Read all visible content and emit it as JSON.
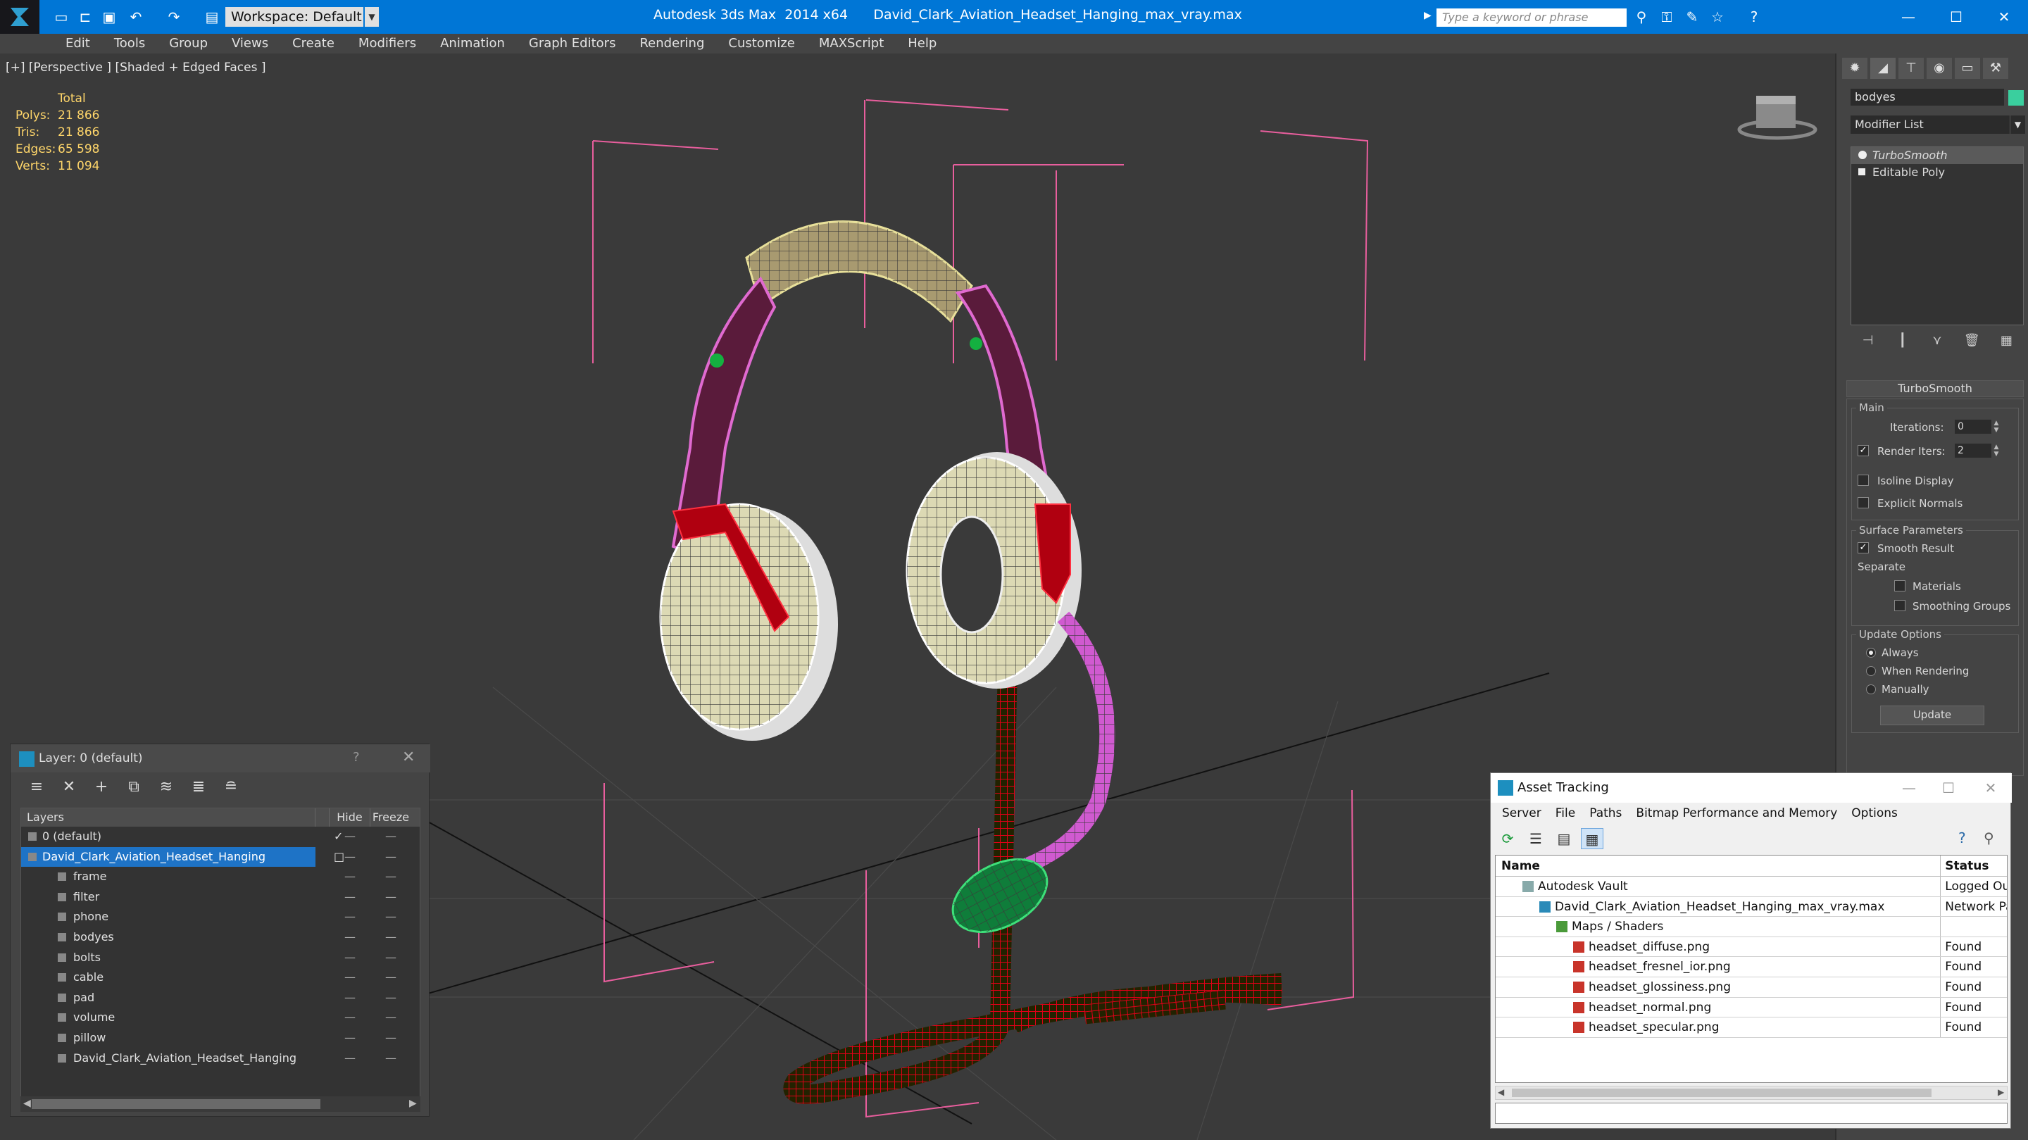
{
  "titlebar": {
    "app_title": "Autodesk 3ds Max  2014 x64",
    "file_name": "David_Clark_Aviation_Headset_Hanging_max_vray.max",
    "workspace": "Workspace: Default",
    "search_placeholder": "Type a keyword or phrase",
    "minimize": "—",
    "maximize": "☐",
    "close": "✕"
  },
  "menu": [
    "Edit",
    "Tools",
    "Group",
    "Views",
    "Create",
    "Modifiers",
    "Animation",
    "Graph Editors",
    "Rendering",
    "Customize",
    "MAXScript",
    "Help"
  ],
  "viewport": {
    "label": "[+] [Perspective ] [Shaded + Edged Faces ]",
    "stats": {
      "header": "Total",
      "rows": [
        {
          "key": "Polys:",
          "value": "21 866"
        },
        {
          "key": "Tris:",
          "value": "21 866"
        },
        {
          "key": "Edges:",
          "value": "65 598"
        },
        {
          "key": "Verts:",
          "value": "11 094"
        }
      ]
    }
  },
  "command_panel": {
    "object_name": "bodyes",
    "object_color": "#3acf9e",
    "modifier_list": "Modifier List",
    "stack": [
      "TurboSmooth",
      "Editable Poly"
    ],
    "rollout_title": "TurboSmooth",
    "main": {
      "title": "Main",
      "iterations_label": "Iterations:",
      "iterations_value": "0",
      "render_iters_label": "Render Iters:",
      "render_iters_value": "2",
      "render_iters_checked": true,
      "isoline": "Isoline Display",
      "explicit_normals": "Explicit Normals"
    },
    "surface": {
      "title": "Surface Parameters",
      "smooth_result": "Smooth Result",
      "separate": "Separate",
      "materials": "Materials",
      "smoothing_groups": "Smoothing Groups"
    },
    "update": {
      "title": "Update Options",
      "always": "Always",
      "when_rendering": "When Rendering",
      "manually": "Manually",
      "button": "Update"
    }
  },
  "layer_panel": {
    "title": "Layer: 0 (default)",
    "help": "?",
    "close": "✕",
    "columns": {
      "layers": "Layers",
      "hide": "Hide",
      "freeze": "Freeze"
    },
    "rows": [
      {
        "name": "0 (default)",
        "level": 0,
        "active": true
      },
      {
        "name": "David_Clark_Aviation_Headset_Hanging",
        "level": 0,
        "selected": true
      },
      {
        "name": "frame",
        "level": 1
      },
      {
        "name": "filter",
        "level": 1
      },
      {
        "name": "phone",
        "level": 1
      },
      {
        "name": "bodyes",
        "level": 1
      },
      {
        "name": "bolts",
        "level": 1
      },
      {
        "name": "cable",
        "level": 1
      },
      {
        "name": "pad",
        "level": 1
      },
      {
        "name": "volume",
        "level": 1
      },
      {
        "name": "pillow",
        "level": 1
      },
      {
        "name": "David_Clark_Aviation_Headset_Hanging",
        "level": 1
      }
    ]
  },
  "asset_tracking": {
    "title": "Asset Tracking",
    "menu": [
      "Server",
      "File",
      "Paths",
      "Bitmap Performance and Memory",
      "Options"
    ],
    "columns": {
      "name": "Name",
      "status": "Status"
    },
    "rows": [
      {
        "name": "Autodesk Vault",
        "status": "Logged Ou",
        "indent": 1
      },
      {
        "name": "David_Clark_Aviation_Headset_Hanging_max_vray.max",
        "status": "Network Pa",
        "indent": 2
      },
      {
        "name": "Maps / Shaders",
        "status": "",
        "indent": 3
      },
      {
        "name": "headset_diffuse.png",
        "status": "Found",
        "indent": 4
      },
      {
        "name": "headset_fresnel_ior.png",
        "status": "Found",
        "indent": 4
      },
      {
        "name": "headset_glossiness.png",
        "status": "Found",
        "indent": 4
      },
      {
        "name": "headset_normal.png",
        "status": "Found",
        "indent": 4
      },
      {
        "name": "headset_specular.png",
        "status": "Found",
        "indent": 4
      }
    ]
  }
}
